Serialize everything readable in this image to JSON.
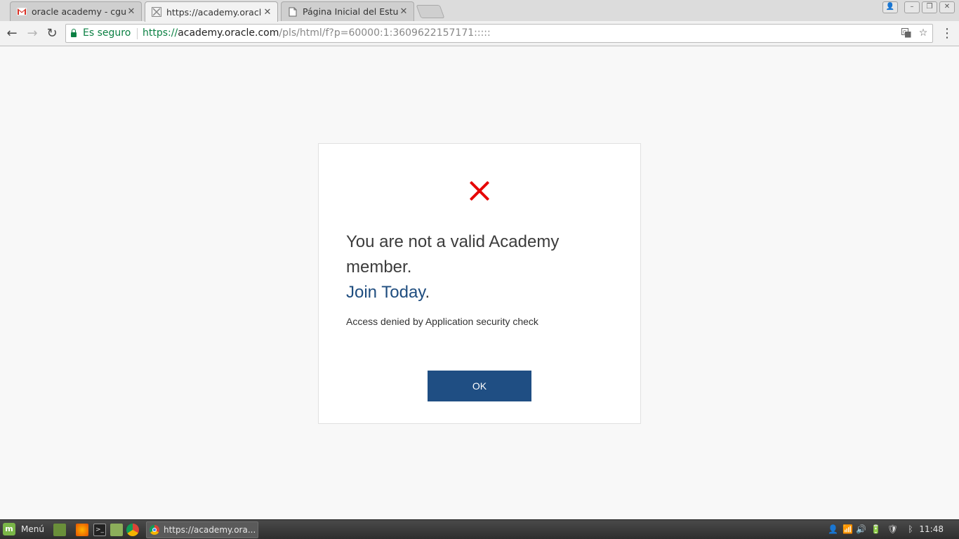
{
  "browser": {
    "tabs": [
      {
        "title": "oracle academy - cgutie",
        "favicon": "gmail-icon",
        "active": false
      },
      {
        "title": "https://academy.oracle.",
        "favicon": "oracle-page-icon",
        "active": true
      },
      {
        "title": "Página Inicial del Estudi",
        "favicon": "document-icon",
        "active": false
      }
    ],
    "security_label": "Es seguro",
    "url": {
      "scheme": "https://",
      "host": "academy.oracle.com",
      "path": "/pls/html/f?p=60000:1:3609622157171:::::"
    }
  },
  "page": {
    "error_icon": "error-x-icon",
    "message_line": "You are not a valid Academy member.",
    "join_link": "Join Today",
    "join_suffix": ".",
    "detail": "Access denied by Application security check",
    "ok_label": "OK",
    "colors": {
      "error": "#e60000",
      "link": "#1f4d7f",
      "button": "#1f4e83"
    }
  },
  "taskbar": {
    "menu_label": "Menú",
    "window_title": "https://academy.ora...",
    "clock": "11:48"
  }
}
